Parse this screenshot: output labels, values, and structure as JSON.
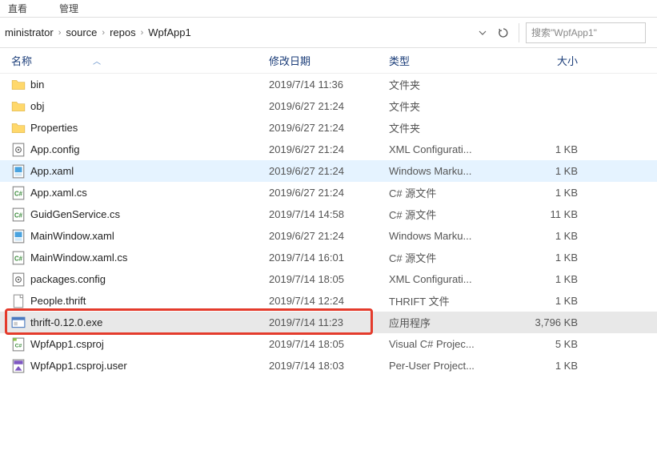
{
  "toolbar": {
    "item1": "直看",
    "item2": "管理"
  },
  "breadcrumb": {
    "seg1": "ministrator",
    "seg2": "source",
    "seg3": "repos",
    "seg4": "WpfApp1"
  },
  "search": {
    "placeholder": "搜索\"WpfApp1\""
  },
  "columns": {
    "name": "名称",
    "date": "修改日期",
    "type": "类型",
    "size": "大小"
  },
  "files": [
    {
      "icon": "folder",
      "name": "bin",
      "date": "2019/7/14 11:36",
      "type": "文件夹",
      "size": ""
    },
    {
      "icon": "folder",
      "name": "obj",
      "date": "2019/6/27 21:24",
      "type": "文件夹",
      "size": ""
    },
    {
      "icon": "folder",
      "name": "Properties",
      "date": "2019/6/27 21:24",
      "type": "文件夹",
      "size": ""
    },
    {
      "icon": "config",
      "name": "App.config",
      "date": "2019/6/27 21:24",
      "type": "XML Configurati...",
      "size": "1 KB"
    },
    {
      "icon": "xaml",
      "name": "App.xaml",
      "date": "2019/6/27 21:24",
      "type": "Windows Marku...",
      "size": "1 KB",
      "hl": "blue"
    },
    {
      "icon": "cs",
      "name": "App.xaml.cs",
      "date": "2019/6/27 21:24",
      "type": "C# 源文件",
      "size": "1 KB"
    },
    {
      "icon": "cs",
      "name": "GuidGenService.cs",
      "date": "2019/7/14 14:58",
      "type": "C# 源文件",
      "size": "11 KB"
    },
    {
      "icon": "xaml",
      "name": "MainWindow.xaml",
      "date": "2019/6/27 21:24",
      "type": "Windows Marku...",
      "size": "1 KB"
    },
    {
      "icon": "cs",
      "name": "MainWindow.xaml.cs",
      "date": "2019/7/14 16:01",
      "type": "C# 源文件",
      "size": "1 KB"
    },
    {
      "icon": "config",
      "name": "packages.config",
      "date": "2019/7/14 18:05",
      "type": "XML Configurati...",
      "size": "1 KB"
    },
    {
      "icon": "file",
      "name": "People.thrift",
      "date": "2019/7/14 12:24",
      "type": "THRIFT 文件",
      "size": "1 KB"
    },
    {
      "icon": "exe",
      "name": "thrift-0.12.0.exe",
      "date": "2019/7/14 11:23",
      "type": "应用程序",
      "size": "3,796 KB",
      "hl": "gray"
    },
    {
      "icon": "csproj",
      "name": "WpfApp1.csproj",
      "date": "2019/7/14 18:05",
      "type": "Visual C# Projec...",
      "size": "5 KB"
    },
    {
      "icon": "user",
      "name": "WpfApp1.csproj.user",
      "date": "2019/7/14 18:03",
      "type": "Per-User Project...",
      "size": "1 KB"
    }
  ],
  "highlight_box": {
    "file_index": 11
  }
}
